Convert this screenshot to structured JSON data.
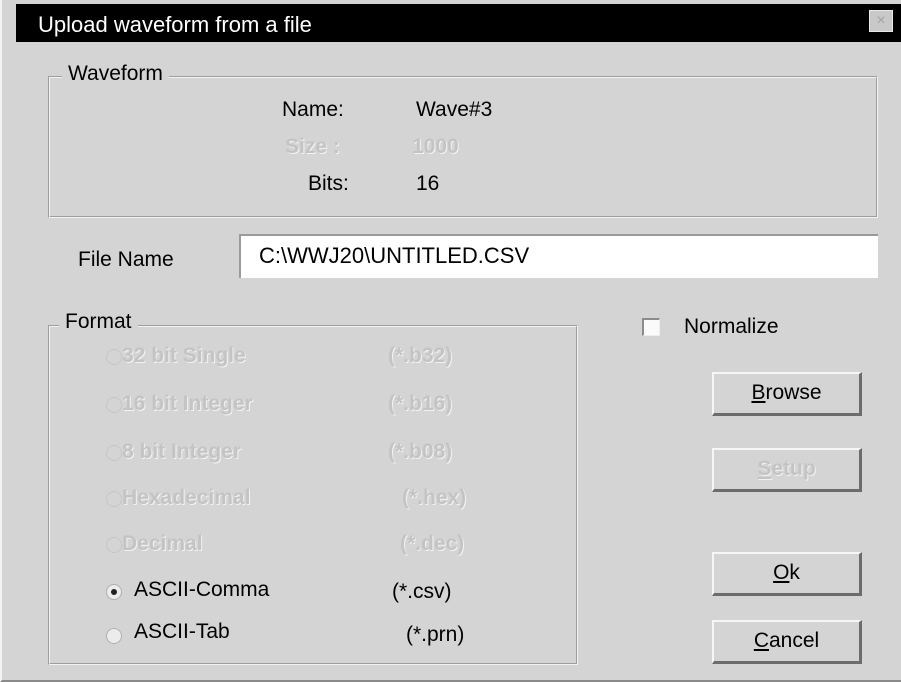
{
  "window": {
    "title": "Upload waveform from a file",
    "close_glyph": "×"
  },
  "waveform": {
    "legend": "Waveform",
    "name_label": "Name:",
    "name_value": "Wave#3",
    "size_label": "Size :",
    "size_value": "1000",
    "bits_label": "Bits:",
    "bits_value": "16"
  },
  "file": {
    "label": "File Name",
    "value": "C:\\WWJ20\\UNTITLED.CSV"
  },
  "format": {
    "legend": "Format",
    "options": [
      {
        "label": "32 bit Single",
        "ext": "(*.b32)",
        "enabled": false,
        "selected": false
      },
      {
        "label": "16 bit Integer",
        "ext": "(*.b16)",
        "enabled": false,
        "selected": false
      },
      {
        "label": "8 bit Integer",
        "ext": "(*.b08)",
        "enabled": false,
        "selected": false
      },
      {
        "label": "Hexadecimal",
        "ext": "(*.hex)",
        "enabled": false,
        "selected": false
      },
      {
        "label": "Decimal",
        "ext": "(*.dec)",
        "enabled": false,
        "selected": false
      },
      {
        "label": "ASCII-Comma",
        "ext": "(*.csv)",
        "enabled": true,
        "selected": true
      },
      {
        "label": "ASCII-Tab",
        "ext": "(*.prn)",
        "enabled": true,
        "selected": false
      }
    ]
  },
  "normalize": {
    "label": "Normalize",
    "checked": false
  },
  "buttons": {
    "browse_mnemonic": "B",
    "browse_rest": "rowse",
    "setup_mnemonic": "S",
    "setup_rest": "etup",
    "ok_mnemonic": "O",
    "ok_rest": "k",
    "cancel_mnemonic": "C",
    "cancel_rest": "ancel"
  }
}
